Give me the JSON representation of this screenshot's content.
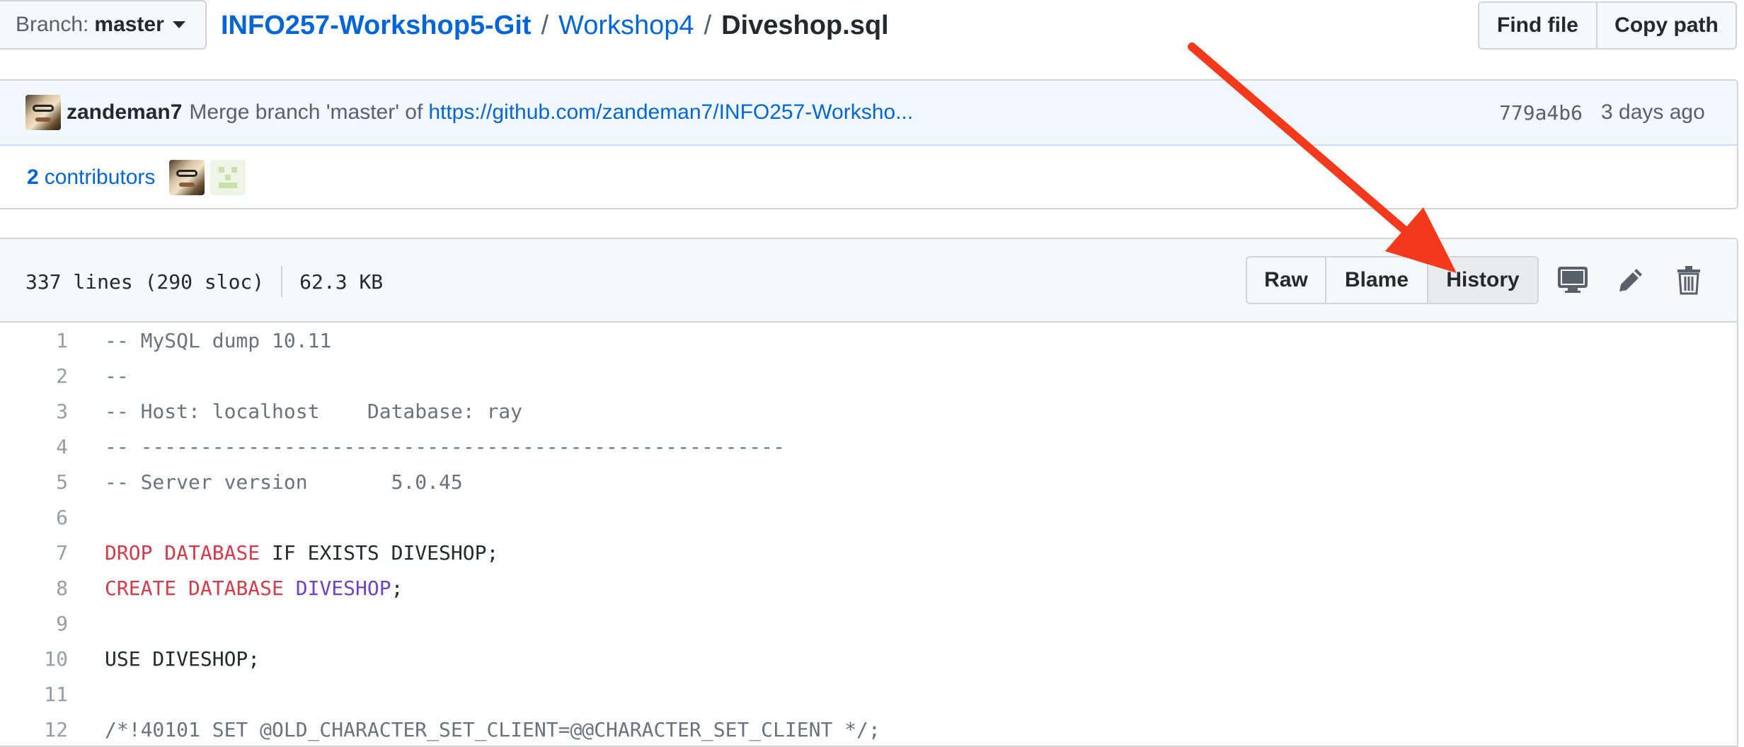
{
  "branch": {
    "label": "Branch:",
    "value": "master"
  },
  "breadcrumb": {
    "repo": "INFO257-Workshop5-Git",
    "sep1": "/",
    "dir": "Workshop4",
    "sep2": "/",
    "file": "Diveshop.sql"
  },
  "top_actions": {
    "find_file": "Find file",
    "copy_path": "Copy path"
  },
  "commit": {
    "author": "zandeman7",
    "message": "Merge branch 'master' of",
    "link": "https://github.com/zandeman7/INFO257-Worksho...",
    "sha": "779a4b6",
    "age": "3 days ago"
  },
  "contributors": {
    "count": "2",
    "label": "contributors"
  },
  "file": {
    "lines_info": "337 lines (290 sloc)",
    "size": "62.3 KB",
    "actions": {
      "raw": "Raw",
      "blame": "Blame",
      "history": "History"
    }
  },
  "icons": [
    "desktop-icon",
    "pencil-icon",
    "trash-icon"
  ],
  "colors": {
    "link": "#0366d6",
    "keyword": "#d73a49",
    "entity": "#6f42c1",
    "comment": "#6a737d",
    "arrow": "#f5391d"
  },
  "code": [
    {
      "n": "1",
      "parts": [
        {
          "t": "-- MySQL dump 10.11",
          "s": "c"
        }
      ]
    },
    {
      "n": "2",
      "parts": [
        {
          "t": "--",
          "s": "c"
        }
      ]
    },
    {
      "n": "3",
      "parts": [
        {
          "t": "-- Host: localhost    Database: ray",
          "s": "c"
        }
      ]
    },
    {
      "n": "4",
      "parts": [
        {
          "t": "-- ------------------------------------------------------",
          "s": "c"
        }
      ]
    },
    {
      "n": "5",
      "parts": [
        {
          "t": "-- Server version\t5.0.45",
          "s": "c"
        }
      ]
    },
    {
      "n": "6",
      "parts": []
    },
    {
      "n": "7",
      "parts": [
        {
          "t": "DROP",
          "s": "k"
        },
        {
          "t": " "
        },
        {
          "t": "DATABASE",
          "s": "k"
        },
        {
          "t": " IF EXISTS DIVESHOP;"
        }
      ]
    },
    {
      "n": "8",
      "parts": [
        {
          "t": "CREATE",
          "s": "k"
        },
        {
          "t": " "
        },
        {
          "t": "DATABASE",
          "s": "k"
        },
        {
          "t": " "
        },
        {
          "t": "DIVESHOP",
          "s": "e"
        },
        {
          "t": ";"
        }
      ]
    },
    {
      "n": "9",
      "parts": []
    },
    {
      "n": "10",
      "parts": [
        {
          "t": "USE DIVESHOP;"
        }
      ]
    },
    {
      "n": "11",
      "parts": []
    },
    {
      "n": "12",
      "parts": [
        {
          "t": "/*!40101 SET @OLD_CHARACTER_SET_CLIENT=@@CHARACTER_SET_CLIENT */;",
          "s": "c"
        }
      ]
    }
  ]
}
